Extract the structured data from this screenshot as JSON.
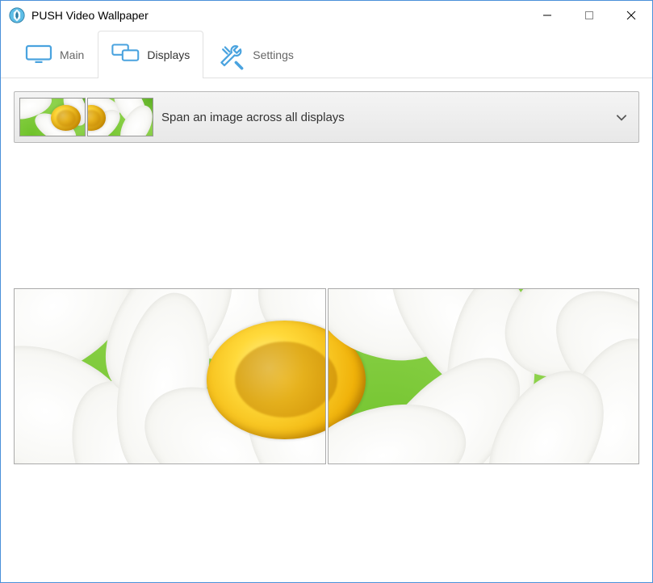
{
  "window": {
    "title": "PUSH Video Wallpaper"
  },
  "tabs": {
    "main": "Main",
    "displays": "Displays",
    "settings": "Settings"
  },
  "option": {
    "label": "Span an image across all displays"
  }
}
